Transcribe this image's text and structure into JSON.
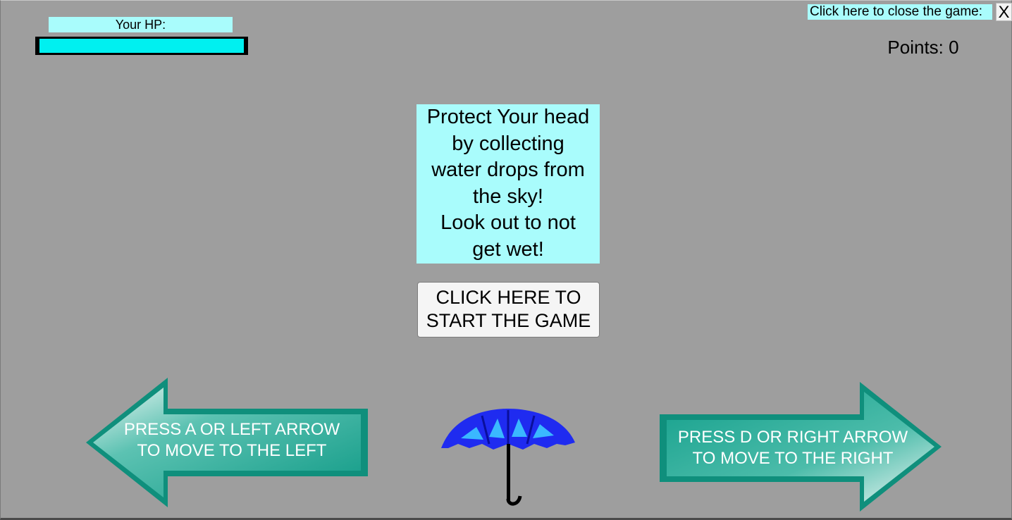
{
  "hud": {
    "hp_label": "Your HP:",
    "hp_value": 1.0,
    "points_text": "Points: 0",
    "close_label": "Click here to close the game:",
    "close_button": "X"
  },
  "intro": {
    "lines": [
      "Protect Your head",
      "by collecting",
      "water drops from",
      "the sky!",
      "Look out to not",
      "get wet!"
    ]
  },
  "start_button": {
    "lines": [
      "CLICK HERE TO",
      "START THE GAME"
    ]
  },
  "controls": {
    "left_lines": [
      "PRESS A OR LEFT ARROW",
      "TO MOVE  TO THE LEFT"
    ],
    "right_lines": [
      "PRESS D OR RIGHT ARROW",
      "TO MOVE  TO THE RIGHT"
    ]
  },
  "player": {
    "icon": "umbrella-icon"
  },
  "colors": {
    "background": "#9e9e9e",
    "panel": "#a9fcfc",
    "hp_fill": "#00f0f0",
    "arrow_teal": "#1aa894",
    "umbrella_blue": "#1f2bf0",
    "umbrella_light": "#3ab8ff"
  }
}
